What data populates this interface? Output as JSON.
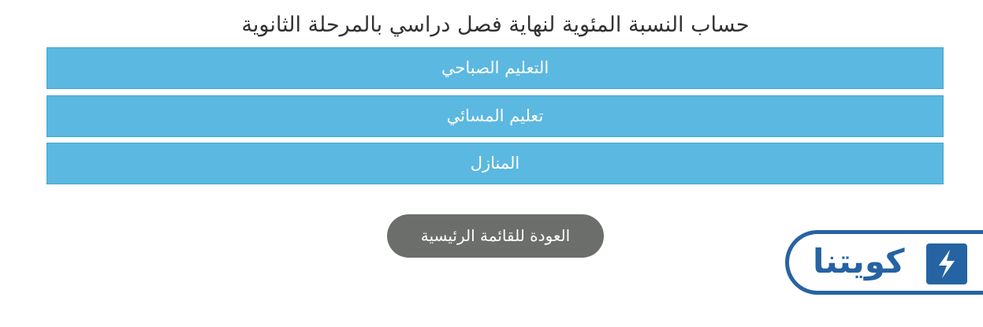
{
  "page": {
    "title": "حساب النسبة المئوية لنهاية فصل دراسي بالمرحلة الثانوية"
  },
  "options": [
    {
      "label": "التعليم الصباحي"
    },
    {
      "label": "تعليم المسائي"
    },
    {
      "label": "المنازل"
    }
  ],
  "back_button": {
    "label": "العودة للقائمة الرئيسية"
  },
  "logo": {
    "text": "كويتنا",
    "icon": "lightning-icon",
    "color": "#2663a3"
  },
  "colors": {
    "option_bg": "#5bb8e0",
    "button_bg": "#6b6e6b"
  }
}
